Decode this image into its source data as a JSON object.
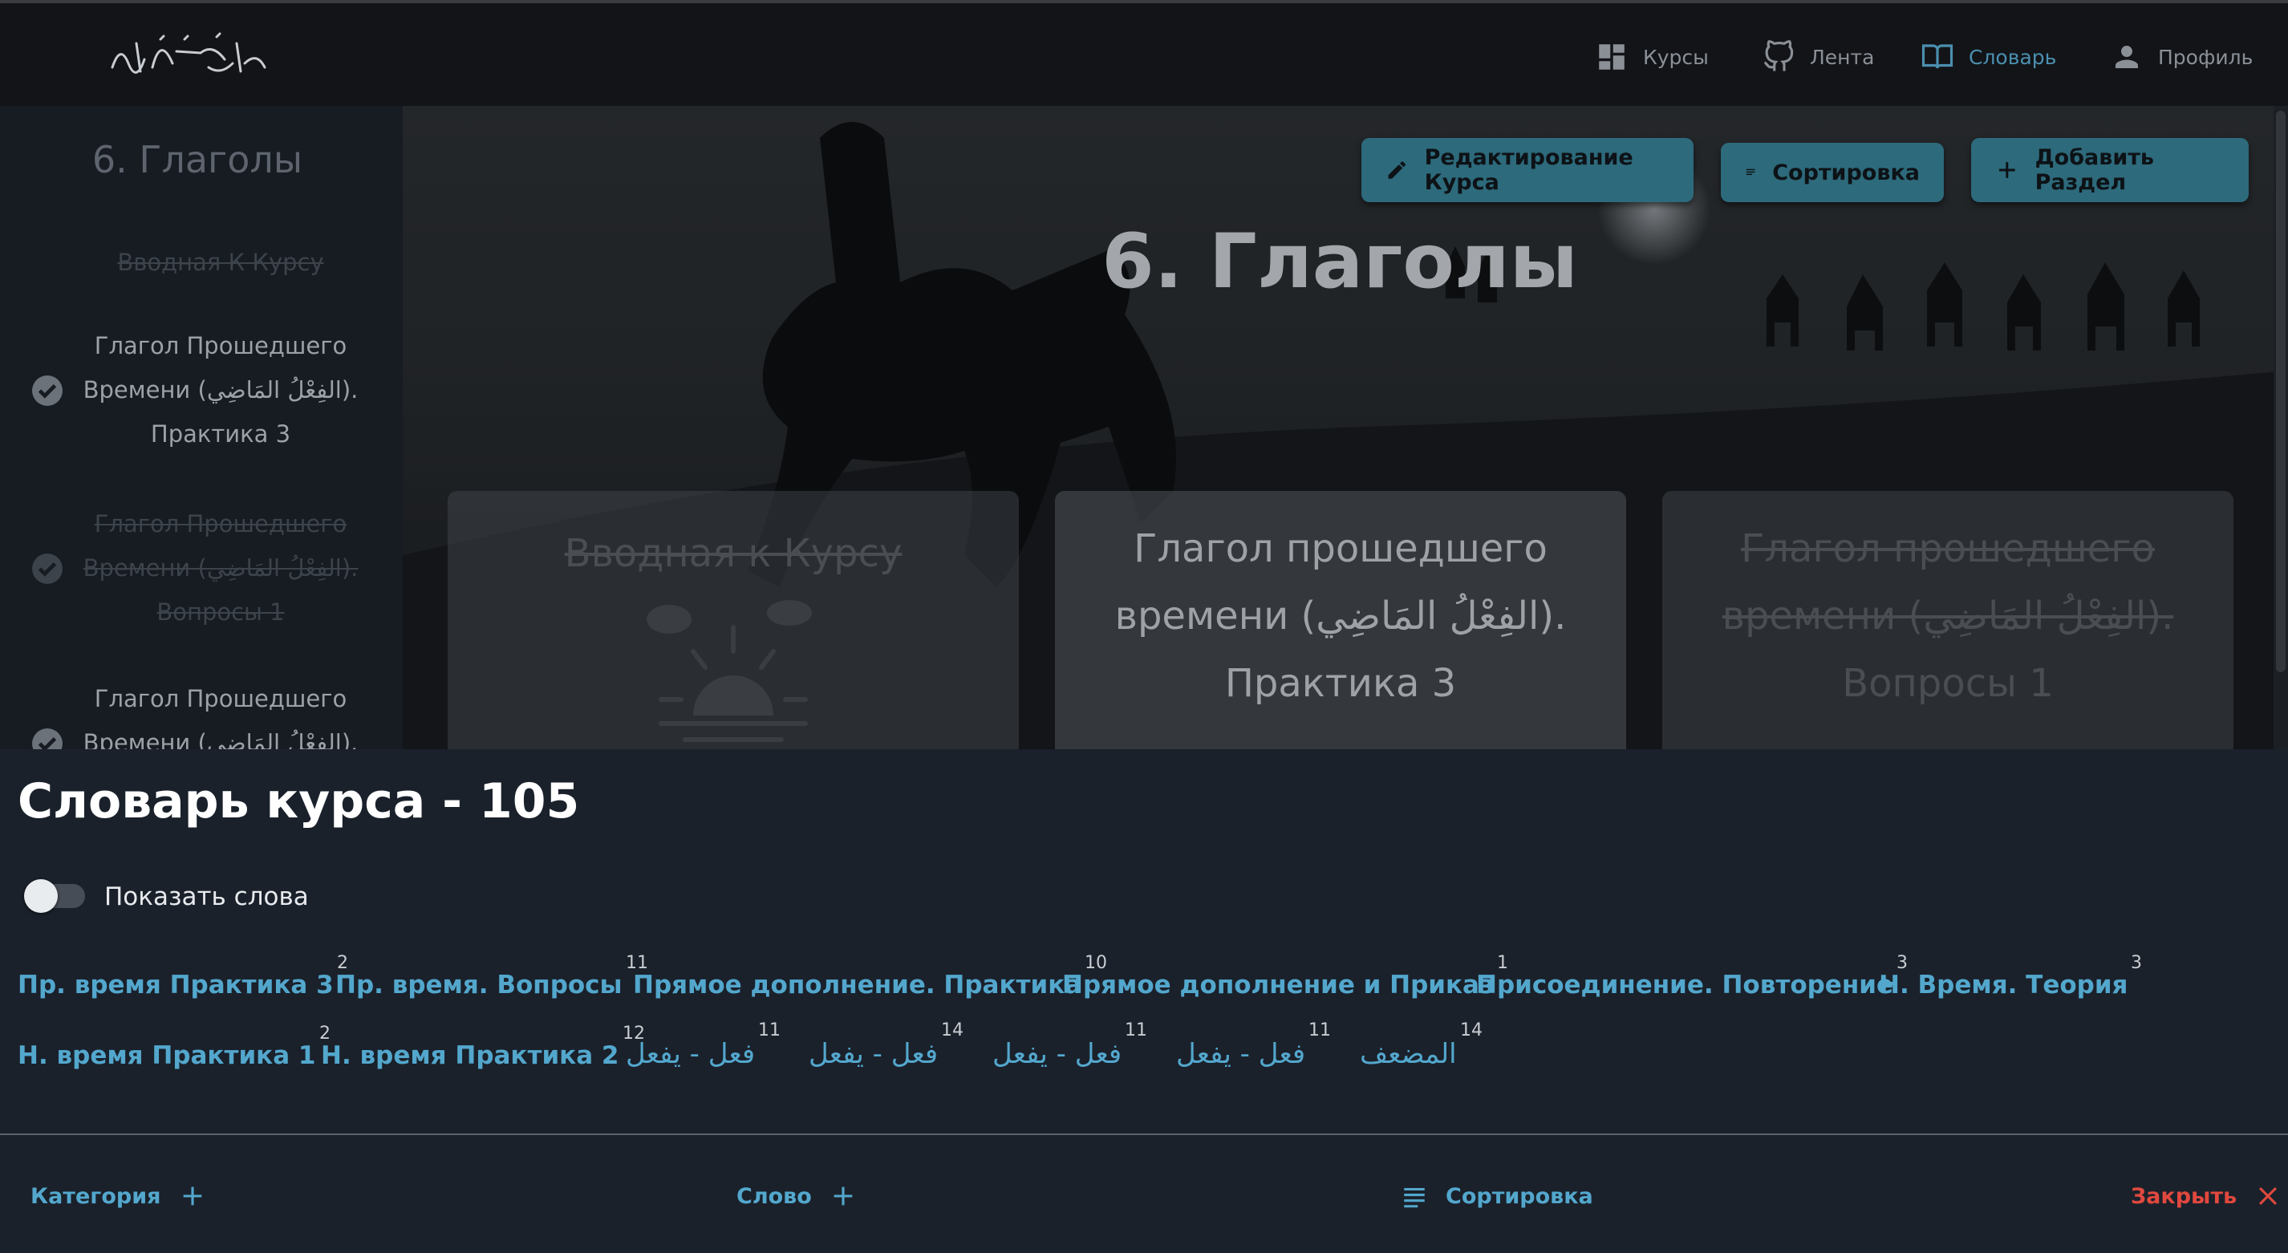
{
  "nav": {
    "logo_text": "وقل رب زدني علما",
    "items": [
      {
        "label": "Курсы",
        "icon": "dashboard-icon"
      },
      {
        "label": "Лента",
        "icon": "github-icon"
      },
      {
        "label": "Словарь",
        "icon": "book-icon"
      },
      {
        "label": "Профиль",
        "icon": "person-icon"
      }
    ]
  },
  "sidebar": {
    "title": "6. Глаголы",
    "items": [
      {
        "text": "Вводная К Курсу",
        "state": "done"
      },
      {
        "line1": "Глагол Прошедшего",
        "line2": "Времени (الفِعْلُ المَاضِي).",
        "line3": "Практика 3",
        "state": "current"
      },
      {
        "line1": "Глагол Прошедшего",
        "line2": "Времени (الفِعْلُ المَاضِي).",
        "line3": "Вопросы 1",
        "state": "done"
      },
      {
        "line1": "Глагол Прошедшего",
        "line2": "Времени (الفِعْلُ المَاضِي).",
        "state": "partial"
      }
    ]
  },
  "hero": {
    "title": "6. Глаголы",
    "buttons": {
      "edit": "Редактирование Курса",
      "sort": "Сортировка",
      "add": "Добавить Раздел"
    },
    "cards": [
      {
        "line1": "Вводная к Курсу",
        "state": "done"
      },
      {
        "line1": "Глагол прошедшего",
        "line2": "времени (الفِعْلُ المَاضِي).",
        "line3": "Практика 3",
        "state": "current"
      },
      {
        "line1": "Глагол прошедшего",
        "line2": "времени (الفِعْلُ المَاضِي).",
        "line3": "Вопросы 1",
        "state": "done"
      }
    ]
  },
  "dictionary": {
    "title": "Словарь курса - 105",
    "toggle_label": "Показать слова",
    "toggle_on": false,
    "categories_row1": [
      {
        "label": "Пр. время Практика 3",
        "count": "2"
      },
      {
        "label": "Пр. время. Вопросы",
        "count": "11"
      },
      {
        "label": "Прямое дополнение. Практика",
        "count": "10"
      },
      {
        "label": "Прямое дополнение и Приказ",
        "count": "1"
      },
      {
        "label": "Присоединение. Повторение",
        "count": "3"
      },
      {
        "label": "Н. Время. Теория",
        "count": "3"
      }
    ],
    "categories_row2": [
      {
        "label": "Н. время Практика 1",
        "count": "2"
      },
      {
        "label": "Н. время Практика 2",
        "count": "12"
      },
      {
        "label": "فعل - يفعل",
        "count": "11"
      },
      {
        "label": "فعل - يفعل",
        "count": "14"
      },
      {
        "label": "فعل - يفعل",
        "count": "11"
      },
      {
        "label": "فعل - يفعل",
        "count": "11"
      },
      {
        "label": "المضعف",
        "count": "14"
      }
    ],
    "footer": {
      "category": "Категория",
      "word": "Слово",
      "sort": "Сортировка",
      "close": "Закрыть"
    }
  },
  "colors": {
    "accent": "#53a7cd",
    "button": "#2d6a7b",
    "close": "#e0483e",
    "panel": "#1a212b"
  }
}
